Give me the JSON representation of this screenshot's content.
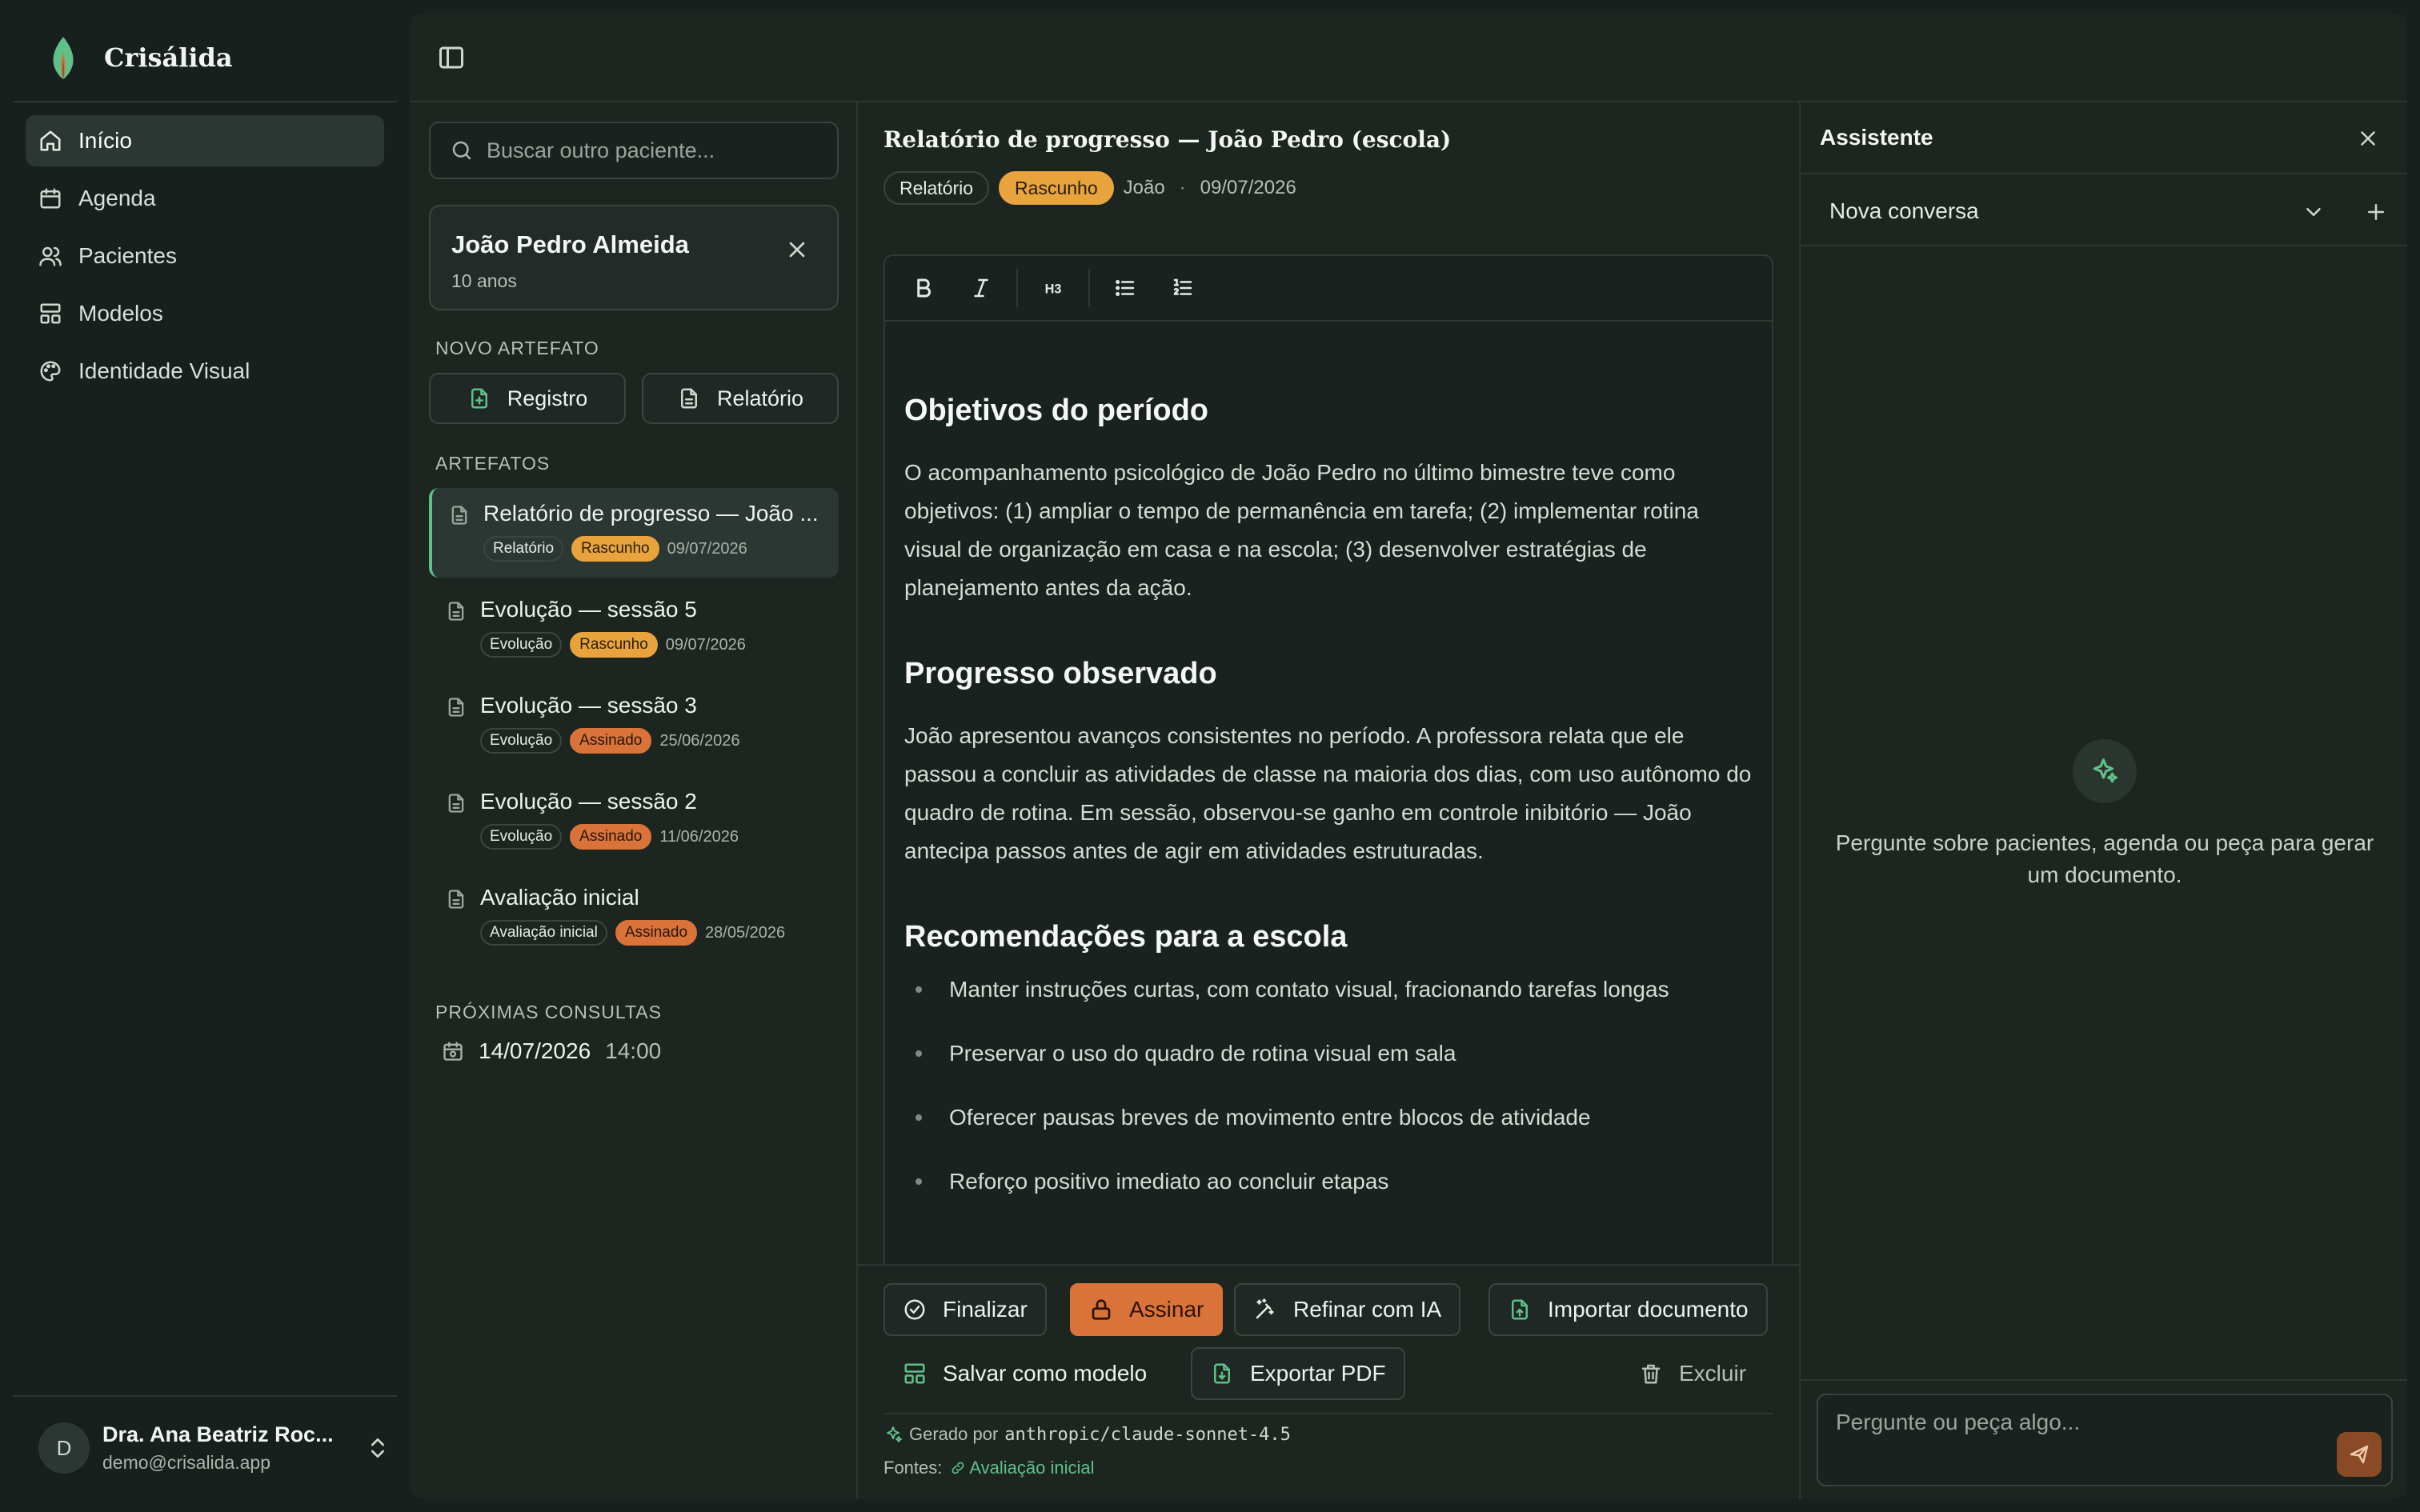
{
  "colors": {
    "accent_green": "#5fc08a",
    "draft": "#e8a33d",
    "signed": "#d9733a",
    "background": "#18201d"
  },
  "sidebar": {
    "brand": "Crisálida",
    "nav": [
      {
        "label": "Início",
        "icon": "home-icon",
        "active": true
      },
      {
        "label": "Agenda",
        "icon": "calendar-icon"
      },
      {
        "label": "Pacientes",
        "icon": "users-icon"
      },
      {
        "label": "Modelos",
        "icon": "layout-icon"
      },
      {
        "label": "Identidade Visual",
        "icon": "palette-icon"
      }
    ],
    "user": {
      "initial": "D",
      "name": "Dra. Ana Beatriz Roc...",
      "email": "demo@crisalida.app"
    }
  },
  "patient_panel": {
    "search_placeholder": "Buscar outro paciente...",
    "patient": {
      "name": "João Pedro Almeida",
      "age": "10 anos"
    },
    "new_artifact_label": "NOVO ARTEFATO",
    "new_buttons": [
      "Registro",
      "Relatório"
    ],
    "artifacts_label": "ARTEFATOS",
    "artifacts": [
      {
        "title": "Relatório de progresso — João ...",
        "type": "Relatório",
        "status": "Rascunho",
        "date": "09/07/2026"
      },
      {
        "title": "Evolução — sessão 5",
        "type": "Evolução",
        "status": "Rascunho",
        "date": "09/07/2026"
      },
      {
        "title": "Evolução — sessão 3",
        "type": "Evolução",
        "status": "Assinado",
        "date": "25/06/2026"
      },
      {
        "title": "Evolução — sessão 2",
        "type": "Evolução",
        "status": "Assinado",
        "date": "11/06/2026"
      },
      {
        "title": "Avaliação inicial",
        "type": "Avaliação inicial",
        "status": "Assinado",
        "date": "28/05/2026"
      }
    ],
    "upcoming_label": "PRÓXIMAS CONSULTAS",
    "upcoming": {
      "date": "14/07/2026",
      "time": "14:00"
    }
  },
  "editor": {
    "title": "Relatório de progresso — João Pedro (escola)",
    "type_chip": "Relatório",
    "status_chip": "Rascunho",
    "author": "João",
    "separator": "·",
    "date": "09/07/2026",
    "toolbar": [
      "bold-icon",
      "italic-icon",
      "heading-3-icon",
      "bullet-list-icon",
      "numbered-list-icon"
    ],
    "toolbar_h3_label": "H3",
    "sections": {
      "h1": "Objetivos do período",
      "p1": "O acompanhamento psicológico de João Pedro no último bimestre teve como objetivos: (1) ampliar o tempo de permanência em tarefa; (2) implementar rotina visual de organização em casa e na escola; (3) desenvolver estratégias de planejamento antes da ação.",
      "h2": "Progresso observado",
      "p2": "João apresentou avanços consistentes no período. A professora relata que ele passou a concluir as atividades de classe na maioria dos dias, com uso autônomo do quadro de rotina. Em sessão, observou-se ganho em controle inibitório — João antecipa passos antes de agir em atividades estruturadas.",
      "h3": "Recomendações para a escola",
      "list": [
        "Manter instruções curtas, com contato visual, fracionando tarefas longas",
        "Preservar o uso do quadro de rotina visual em sala",
        "Oferecer pausas breves de movimento entre blocos de atividade",
        "Reforço positivo imediato ao concluir etapas"
      ]
    },
    "actions": {
      "finalize": "Finalizar",
      "sign": "Assinar",
      "refine": "Refinar com IA",
      "import": "Importar documento",
      "save_template": "Salvar como modelo",
      "export_pdf": "Exportar PDF",
      "delete": "Excluir"
    },
    "generated_by_label": "Gerado por",
    "model": "anthropic/claude-sonnet-4.5",
    "sources_label": "Fontes:",
    "source_link": "Avaliação inicial"
  },
  "assistant": {
    "title": "Assistente",
    "conversation": "Nova conversa",
    "empty_text": "Pergunte sobre pacientes, agenda ou peça para gerar um documento.",
    "input_placeholder": "Pergunte ou peça algo..."
  }
}
